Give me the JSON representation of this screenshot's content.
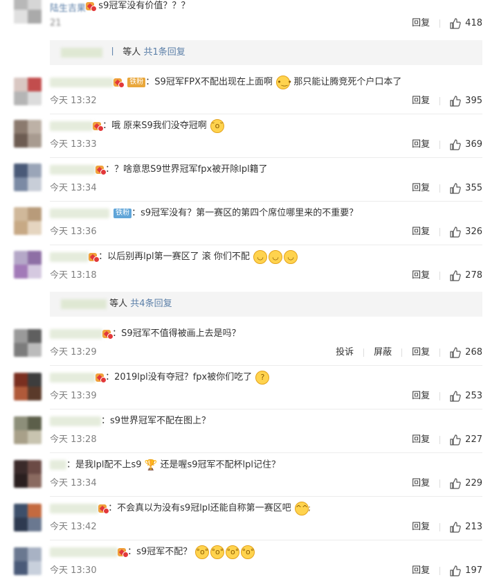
{
  "actions": {
    "reply": "回复",
    "report": "投诉",
    "block": "屏蔽"
  },
  "colors": {
    "link": "#5b7fa8",
    "accent_gold": "#e9a73b",
    "accent_iron": "#60a5d8"
  },
  "top": {
    "name": "陆生吉果",
    "text": "s9冠军没有价值？？？",
    "time": "21",
    "likes": "418"
  },
  "reply1": {
    "pipe": "丨",
    "label": "等人",
    "more": "共1条回复"
  },
  "reply2": {
    "label": "等人",
    "more": "共4条回复"
  },
  "comments": [
    {
      "text": "S9冠军FPX不配出现在上面啊",
      "text2": "那只能让腾竞死个户口本了",
      "tag": "铁粉",
      "time": "今天 13:32",
      "likes": "395"
    },
    {
      "text": "哦 原来S9我们没夺冠啊",
      "time": "今天 13:33",
      "likes": "369"
    },
    {
      "text": "？啥意思S9世界冠军fpx被开除lpl籍了",
      "time": "今天 13:34",
      "likes": "355"
    },
    {
      "text": "s9冠军没有？第一赛区的第四个席位哪里来的不重要？",
      "tag": "铁粉",
      "time": "今天 13:36",
      "likes": "326"
    },
    {
      "text": "以后别再lpl第一赛区了 滚 你们不配",
      "time": "今天 13:18",
      "likes": "278"
    },
    {
      "text": "S9冠军不值得被画上去是吗？",
      "time": "今天 13:29",
      "likes": "268"
    },
    {
      "text": "2019lpl没有夺冠？fpx被你们吃了",
      "time": "今天 13:39",
      "likes": "253"
    },
    {
      "text": "s9世界冠军不配在图上？",
      "time": "今天 13:28",
      "likes": "227"
    },
    {
      "text": "是我lpl配不上s9",
      "text2": "还是喔s9冠军不配杯lpl记住？",
      "time": "今天 13:34",
      "likes": "229"
    },
    {
      "text": "不会真以为没有s9冠lpl还能自称第一赛区吧",
      "time": "今天 13:42",
      "likes": "213"
    },
    {
      "text": "s9冠军不配？",
      "time": "今天 13:30",
      "likes": "197"
    }
  ]
}
